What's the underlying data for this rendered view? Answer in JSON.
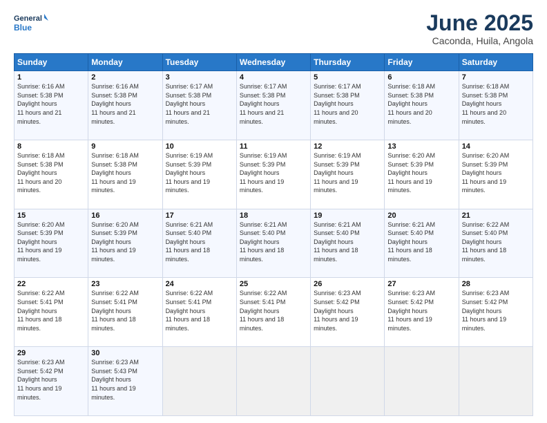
{
  "header": {
    "logo_line1": "General",
    "logo_line2": "Blue",
    "title": "June 2025",
    "location": "Caconda, Huila, Angola"
  },
  "weekdays": [
    "Sunday",
    "Monday",
    "Tuesday",
    "Wednesday",
    "Thursday",
    "Friday",
    "Saturday"
  ],
  "weeks": [
    [
      {
        "day": "1",
        "sunrise": "6:16 AM",
        "sunset": "5:38 PM",
        "daylight": "11 hours and 21 minutes."
      },
      {
        "day": "2",
        "sunrise": "6:16 AM",
        "sunset": "5:38 PM",
        "daylight": "11 hours and 21 minutes."
      },
      {
        "day": "3",
        "sunrise": "6:17 AM",
        "sunset": "5:38 PM",
        "daylight": "11 hours and 21 minutes."
      },
      {
        "day": "4",
        "sunrise": "6:17 AM",
        "sunset": "5:38 PM",
        "daylight": "11 hours and 21 minutes."
      },
      {
        "day": "5",
        "sunrise": "6:17 AM",
        "sunset": "5:38 PM",
        "daylight": "11 hours and 20 minutes."
      },
      {
        "day": "6",
        "sunrise": "6:18 AM",
        "sunset": "5:38 PM",
        "daylight": "11 hours and 20 minutes."
      },
      {
        "day": "7",
        "sunrise": "6:18 AM",
        "sunset": "5:38 PM",
        "daylight": "11 hours and 20 minutes."
      }
    ],
    [
      {
        "day": "8",
        "sunrise": "6:18 AM",
        "sunset": "5:38 PM",
        "daylight": "11 hours and 20 minutes."
      },
      {
        "day": "9",
        "sunrise": "6:18 AM",
        "sunset": "5:38 PM",
        "daylight": "11 hours and 19 minutes."
      },
      {
        "day": "10",
        "sunrise": "6:19 AM",
        "sunset": "5:39 PM",
        "daylight": "11 hours and 19 minutes."
      },
      {
        "day": "11",
        "sunrise": "6:19 AM",
        "sunset": "5:39 PM",
        "daylight": "11 hours and 19 minutes."
      },
      {
        "day": "12",
        "sunrise": "6:19 AM",
        "sunset": "5:39 PM",
        "daylight": "11 hours and 19 minutes."
      },
      {
        "day": "13",
        "sunrise": "6:20 AM",
        "sunset": "5:39 PM",
        "daylight": "11 hours and 19 minutes."
      },
      {
        "day": "14",
        "sunrise": "6:20 AM",
        "sunset": "5:39 PM",
        "daylight": "11 hours and 19 minutes."
      }
    ],
    [
      {
        "day": "15",
        "sunrise": "6:20 AM",
        "sunset": "5:39 PM",
        "daylight": "11 hours and 19 minutes."
      },
      {
        "day": "16",
        "sunrise": "6:20 AM",
        "sunset": "5:39 PM",
        "daylight": "11 hours and 19 minutes."
      },
      {
        "day": "17",
        "sunrise": "6:21 AM",
        "sunset": "5:40 PM",
        "daylight": "11 hours and 18 minutes."
      },
      {
        "day": "18",
        "sunrise": "6:21 AM",
        "sunset": "5:40 PM",
        "daylight": "11 hours and 18 minutes."
      },
      {
        "day": "19",
        "sunrise": "6:21 AM",
        "sunset": "5:40 PM",
        "daylight": "11 hours and 18 minutes."
      },
      {
        "day": "20",
        "sunrise": "6:21 AM",
        "sunset": "5:40 PM",
        "daylight": "11 hours and 18 minutes."
      },
      {
        "day": "21",
        "sunrise": "6:22 AM",
        "sunset": "5:40 PM",
        "daylight": "11 hours and 18 minutes."
      }
    ],
    [
      {
        "day": "22",
        "sunrise": "6:22 AM",
        "sunset": "5:41 PM",
        "daylight": "11 hours and 18 minutes."
      },
      {
        "day": "23",
        "sunrise": "6:22 AM",
        "sunset": "5:41 PM",
        "daylight": "11 hours and 18 minutes."
      },
      {
        "day": "24",
        "sunrise": "6:22 AM",
        "sunset": "5:41 PM",
        "daylight": "11 hours and 18 minutes."
      },
      {
        "day": "25",
        "sunrise": "6:22 AM",
        "sunset": "5:41 PM",
        "daylight": "11 hours and 18 minutes."
      },
      {
        "day": "26",
        "sunrise": "6:23 AM",
        "sunset": "5:42 PM",
        "daylight": "11 hours and 19 minutes."
      },
      {
        "day": "27",
        "sunrise": "6:23 AM",
        "sunset": "5:42 PM",
        "daylight": "11 hours and 19 minutes."
      },
      {
        "day": "28",
        "sunrise": "6:23 AM",
        "sunset": "5:42 PM",
        "daylight": "11 hours and 19 minutes."
      }
    ],
    [
      {
        "day": "29",
        "sunrise": "6:23 AM",
        "sunset": "5:42 PM",
        "daylight": "11 hours and 19 minutes."
      },
      {
        "day": "30",
        "sunrise": "6:23 AM",
        "sunset": "5:43 PM",
        "daylight": "11 hours and 19 minutes."
      },
      null,
      null,
      null,
      null,
      null
    ]
  ]
}
